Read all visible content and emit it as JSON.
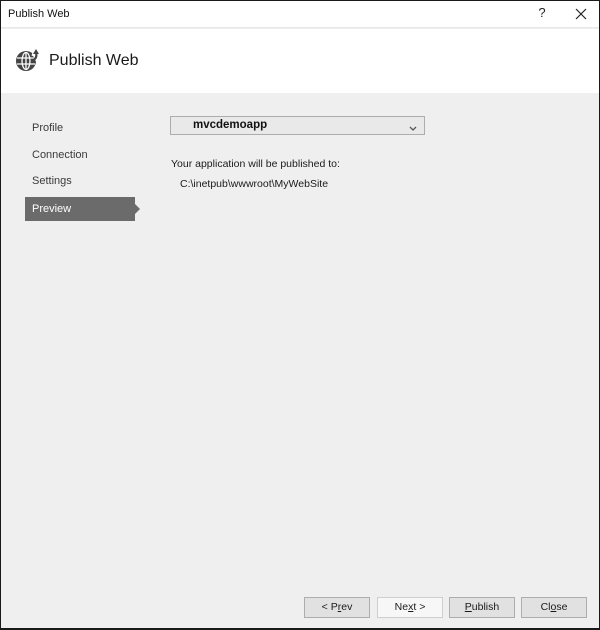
{
  "window": {
    "title": "Publish Web",
    "help_label": "?",
    "close_icon": "close-icon"
  },
  "header": {
    "title": "Publish Web",
    "icon": "globe-publish-icon"
  },
  "sidebar": {
    "items": [
      {
        "label": "Profile",
        "active": false
      },
      {
        "label": "Connection",
        "active": false
      },
      {
        "label": "Settings",
        "active": false
      },
      {
        "label": "Preview",
        "active": true
      }
    ]
  },
  "main": {
    "profile_select": {
      "value": "mvcdemoapp"
    },
    "publish_label": "Your application will be published to:",
    "publish_path": "C:\\inetpub\\wwwroot\\MyWebSite"
  },
  "footer": {
    "buttons": {
      "prev": {
        "pre": "< P",
        "accel": "r",
        "post": "ev"
      },
      "next": {
        "pre": "Ne",
        "accel": "x",
        "post": "t >"
      },
      "publish": {
        "pre": "",
        "accel": "P",
        "post": "ublish"
      },
      "close": {
        "pre": "Cl",
        "accel": "o",
        "post": "se"
      }
    }
  },
  "colors": {
    "active_nav": "#6b6b6b",
    "dialog_bg": "#efefef"
  }
}
